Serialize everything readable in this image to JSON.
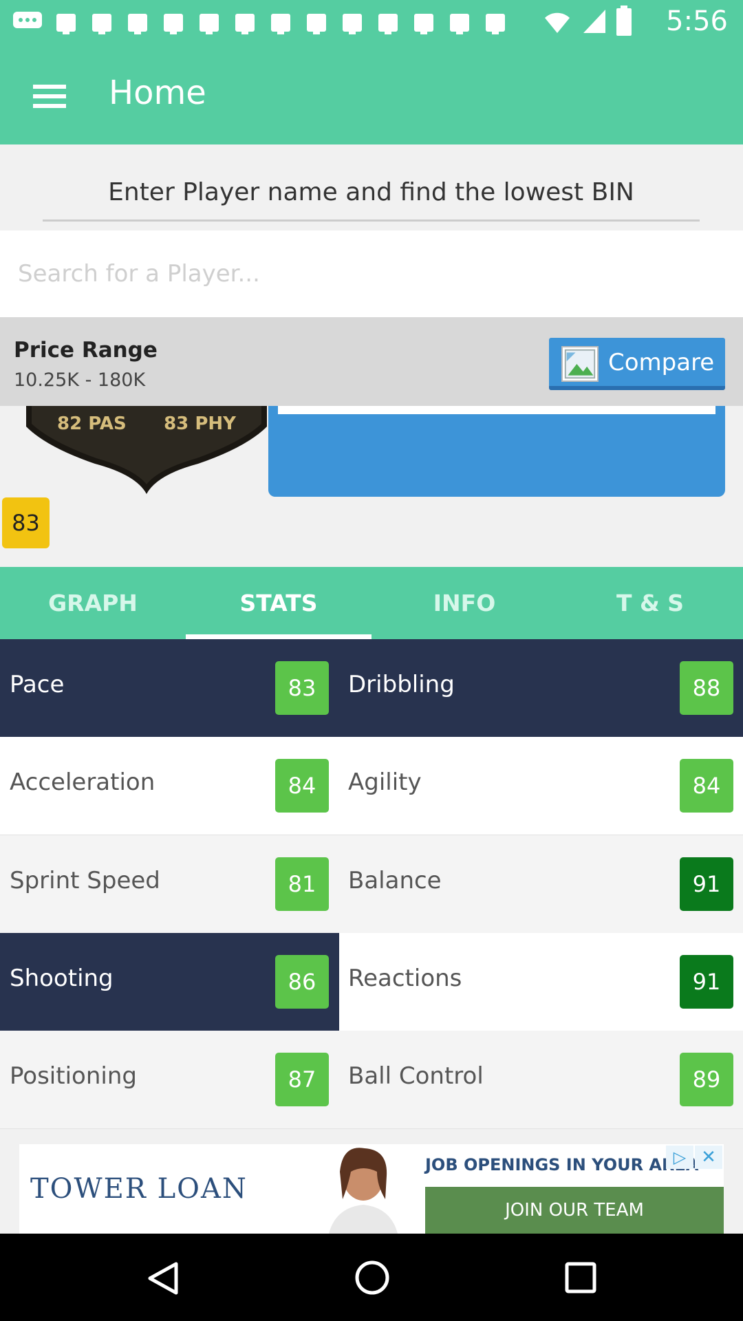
{
  "status_bar": {
    "time": "5:56"
  },
  "app_bar": {
    "title": "Home"
  },
  "search": {
    "hint": "Enter Player name and find the lowest BIN",
    "placeholder": "Search for a Player..."
  },
  "card": {
    "stats_line": "82 PAS      83 PHY",
    "rating": "83"
  },
  "price": {
    "label": "Price Range",
    "value": "10.25K - 180K",
    "compare_label": "Compare"
  },
  "tabs": [
    {
      "label": "GRAPH",
      "active": false
    },
    {
      "label": "STATS",
      "active": true
    },
    {
      "label": "INFO",
      "active": false
    },
    {
      "label": "T & S",
      "active": false
    }
  ],
  "stats": [
    {
      "left": {
        "label": "Pace",
        "value": "83"
      },
      "right": {
        "label": "Dribbling",
        "value": "88"
      }
    },
    {
      "left": {
        "label": "Acceleration",
        "value": "84"
      },
      "right": {
        "label": "Agility",
        "value": "84"
      }
    },
    {
      "left": {
        "label": "Sprint Speed",
        "value": "81"
      },
      "right": {
        "label": "Balance",
        "value": "91"
      }
    },
    {
      "left": {
        "label": "Shooting",
        "value": "86"
      },
      "right": {
        "label": "Reactions",
        "value": "91"
      }
    },
    {
      "left": {
        "label": "Positioning",
        "value": "87"
      },
      "right": {
        "label": "Ball Control",
        "value": "89"
      }
    }
  ],
  "ad": {
    "brand": "TOWER LOAN",
    "headline": "JOB OPENINGS IN YOUR AREA",
    "cta": "JOIN OUR TEAM"
  },
  "colors": {
    "primary": "#55cda1",
    "header_dark": "#28334f",
    "good_value": "#5cc44a",
    "great_value": "#0a7a1c",
    "accent_blue": "#3d94d8",
    "rating_gold": "#f2c311"
  },
  "icons": {
    "menu": "hamburger-icon",
    "compare": "image-placeholder-icon",
    "back": "triangle-back-icon",
    "home": "circle-home-icon",
    "recents": "square-recents-icon"
  }
}
